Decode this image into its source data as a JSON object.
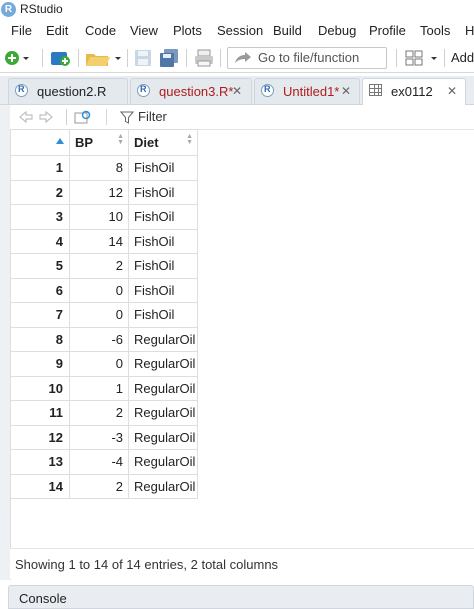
{
  "window": {
    "title": "RStudio"
  },
  "menu": [
    "File",
    "Edit",
    "Code",
    "View",
    "Plots",
    "Session",
    "Build",
    "Debug",
    "Profile",
    "Tools",
    "H"
  ],
  "toolbar": {
    "goto_placeholder": "Go to file/function",
    "addins_label": "Addi"
  },
  "tabs": [
    {
      "label": "question2.R",
      "icon": "r-file-icon",
      "modified": false,
      "color": "#222222"
    },
    {
      "label": "question3.R*",
      "icon": "r-file-icon",
      "modified": true,
      "color": "#b01c1c"
    },
    {
      "label": "Untitled1*",
      "icon": "r-file-icon",
      "modified": true,
      "color": "#b01c1c"
    },
    {
      "label": "ex0112",
      "icon": "table-icon",
      "modified": false,
      "active": true,
      "color": "#222222"
    }
  ],
  "viewer": {
    "filter_label": "Filter"
  },
  "table": {
    "columns": [
      "BP",
      "Diet"
    ],
    "rows": [
      {
        "idx": "1",
        "bp": "8",
        "diet": "FishOil"
      },
      {
        "idx": "2",
        "bp": "12",
        "diet": "FishOil"
      },
      {
        "idx": "3",
        "bp": "10",
        "diet": "FishOil"
      },
      {
        "idx": "4",
        "bp": "14",
        "diet": "FishOil"
      },
      {
        "idx": "5",
        "bp": "2",
        "diet": "FishOil"
      },
      {
        "idx": "6",
        "bp": "0",
        "diet": "FishOil"
      },
      {
        "idx": "7",
        "bp": "0",
        "diet": "FishOil"
      },
      {
        "idx": "8",
        "bp": "-6",
        "diet": "RegularOil"
      },
      {
        "idx": "9",
        "bp": "0",
        "diet": "RegularOil"
      },
      {
        "idx": "10",
        "bp": "1",
        "diet": "RegularOil"
      },
      {
        "idx": "11",
        "bp": "2",
        "diet": "RegularOil"
      },
      {
        "idx": "12",
        "bp": "-3",
        "diet": "RegularOil"
      },
      {
        "idx": "13",
        "bp": "-4",
        "diet": "RegularOil"
      },
      {
        "idx": "14",
        "bp": "2",
        "diet": "RegularOil"
      }
    ]
  },
  "status": {
    "text": "Showing 1 to 14 of 14 entries, 2 total columns"
  },
  "console": {
    "label": "Console"
  },
  "colors": {
    "accent": "#2a8fd8",
    "modified_tab": "#b01c1c",
    "r_logo": "#75aadb"
  }
}
